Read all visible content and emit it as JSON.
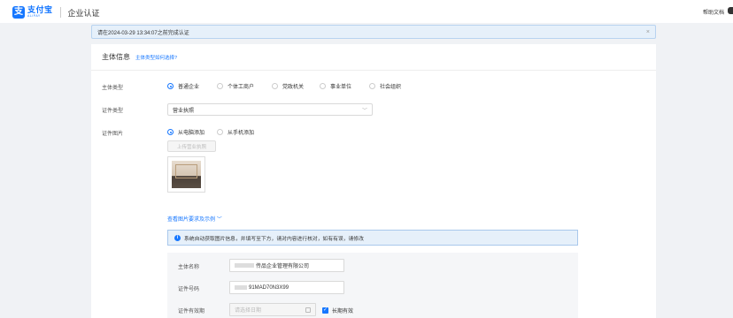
{
  "header": {
    "logo_mark": "支",
    "logo_cn": "支付宝",
    "logo_en": "ALIPAY",
    "page_name": "企业认证",
    "help": "帮助文档"
  },
  "notice": {
    "text": "请在2024-03-29 13:34:07之前完成认证",
    "close": "×"
  },
  "section": {
    "title": "主体信息",
    "hint": "主体类型如何选择?"
  },
  "entity_type": {
    "label": "主体类型",
    "options": [
      "普通企业",
      "个体工商户",
      "党政机关",
      "事业单位",
      "社会组织"
    ],
    "selected": "普通企业"
  },
  "cert_type": {
    "label": "证件类型",
    "value": "营业执照"
  },
  "cert_image": {
    "label": "证件图片",
    "options": [
      "从电脑添加",
      "从手机添加"
    ],
    "selected": "从电脑添加",
    "upload_button": "上传营业执照"
  },
  "example_link": "查看图片要求及示例",
  "info_message": "系统自动获取图片信息，并填写至下方，请对内容进行核对，如有有误，请修改",
  "details": {
    "name_label": "主体名称",
    "name_value": "传品企业管理有限公司",
    "number_label": "证件号码",
    "number_value": "91MAD70N3X99",
    "validity_label": "证件有效期",
    "validity_placeholder": "请选择日期",
    "long_term_label": "长期有效",
    "long_term_checked": true
  },
  "colors": {
    "accent": "#1677ff",
    "notice_bg": "#e6f0fa",
    "page_bg": "#f0f2f5"
  }
}
